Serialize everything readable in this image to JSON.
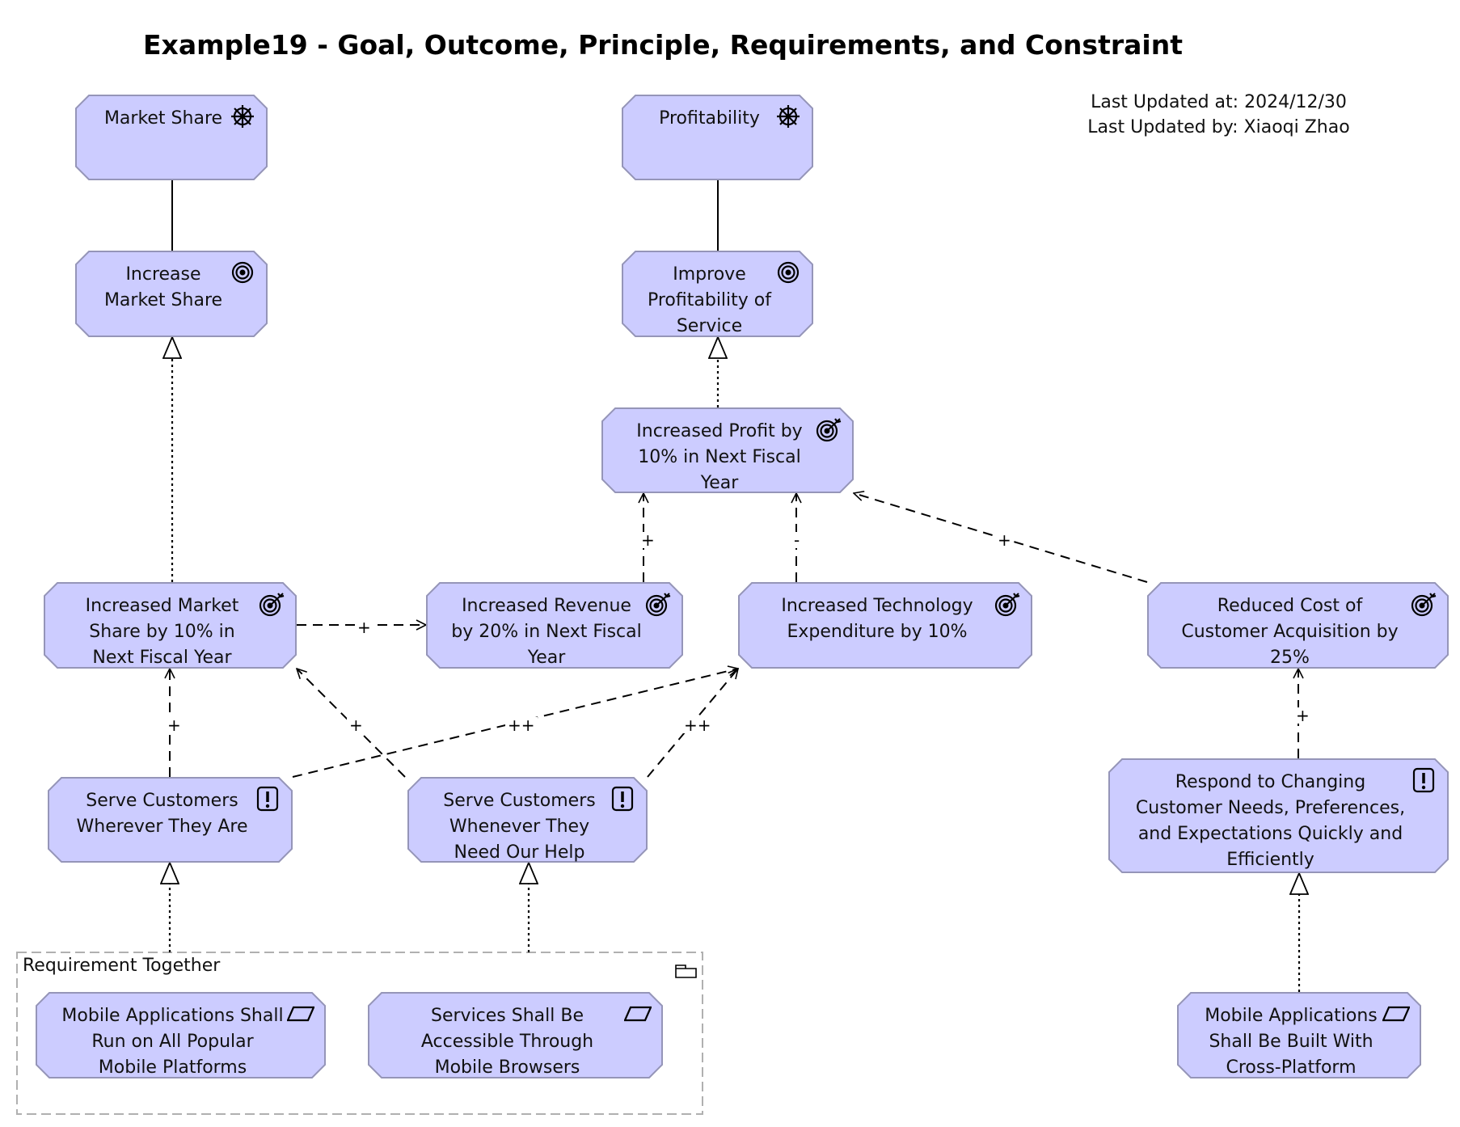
{
  "title": "Example19 - Goal, Outcome, Principle, Requirements, and Constraint",
  "meta": {
    "last_updated_at": "Last Updated at: 2024/12/30",
    "last_updated_by": "Last Updated by: Xiaoqi Zhao"
  },
  "colors": {
    "node_fill": "#ccccff",
    "node_border": "#9595b8",
    "line": "#000000",
    "group_border": "#b0b0b0"
  },
  "group": {
    "label": "Requirement Together",
    "icon": "folder-icon"
  },
  "nodes": {
    "market_share": {
      "label": "Market Share",
      "type": "driver",
      "icon": "driver-wheel-icon"
    },
    "profitability": {
      "label": "Profitability",
      "type": "driver",
      "icon": "driver-wheel-icon"
    },
    "increase_market_share": {
      "label": "Increase Market Share",
      "type": "goal",
      "icon": "goal-target-icon"
    },
    "improve_profitability": {
      "label": "Improve Profitability of Service",
      "type": "goal",
      "icon": "goal-target-icon"
    },
    "increased_profit": {
      "label": "Increased Profit by 10% in Next Fiscal Year",
      "type": "outcome",
      "icon": "outcome-arrow-target-icon"
    },
    "increased_market_share_10": {
      "label": "Increased Market Share by 10% in Next Fiscal Year",
      "type": "outcome",
      "icon": "outcome-arrow-target-icon"
    },
    "increased_revenue": {
      "label": "Increased Revenue by 20% in Next Fiscal Year",
      "type": "outcome",
      "icon": "outcome-arrow-target-icon"
    },
    "increased_tech": {
      "label": "Increased Technology Expenditure by 10%",
      "type": "outcome",
      "icon": "outcome-arrow-target-icon"
    },
    "reduced_cost": {
      "label": "Reduced Cost of Customer Acquisition by 25%",
      "type": "outcome",
      "icon": "outcome-arrow-target-icon"
    },
    "serve_wherever": {
      "label": "Serve Customers Wherever They Are",
      "type": "principle",
      "icon": "principle-exclamation-icon"
    },
    "serve_whenever": {
      "label": "Serve Customers Whenever They Need Our Help",
      "type": "principle",
      "icon": "principle-exclamation-icon"
    },
    "respond_changing": {
      "label": "Respond to Changing Customer Needs, Preferences, and Expectations Quickly and Efficiently",
      "type": "principle",
      "icon": "principle-exclamation-icon"
    },
    "mobile_run": {
      "label": "Mobile Applications Shall Run on All Popular Mobile Platforms",
      "type": "requirement",
      "icon": "requirement-parallelogram-icon"
    },
    "services_browsers": {
      "label": "Services Shall Be Accessible Through Mobile Browsers",
      "type": "requirement",
      "icon": "requirement-parallelogram-icon"
    },
    "mobile_built": {
      "label": "Mobile Applications Shall Be Built With Cross-Platform",
      "type": "requirement",
      "icon": "requirement-parallelogram-icon"
    }
  },
  "relations": [
    {
      "from": "market_share",
      "to": "increase_market_share",
      "type": "association",
      "label": ""
    },
    {
      "from": "profitability",
      "to": "improve_profitability",
      "type": "association",
      "label": ""
    },
    {
      "from": "increased_market_share_10",
      "to": "increase_market_share",
      "type": "realization",
      "label": ""
    },
    {
      "from": "increased_profit",
      "to": "improve_profitability",
      "type": "realization",
      "label": ""
    },
    {
      "from": "increased_revenue",
      "to": "increased_profit",
      "type": "influence",
      "label": "+"
    },
    {
      "from": "increased_tech",
      "to": "increased_profit",
      "type": "influence",
      "label": "-"
    },
    {
      "from": "reduced_cost",
      "to": "increased_profit",
      "type": "influence",
      "label": "+"
    },
    {
      "from": "increased_market_share_10",
      "to": "increased_revenue",
      "type": "influence",
      "label": "+"
    },
    {
      "from": "serve_wherever",
      "to": "increased_market_share_10",
      "type": "influence",
      "label": "+"
    },
    {
      "from": "serve_whenever",
      "to": "increased_market_share_10",
      "type": "influence",
      "label": "+"
    },
    {
      "from": "serve_wherever",
      "to": "increased_tech",
      "type": "influence",
      "label": "++"
    },
    {
      "from": "serve_whenever",
      "to": "increased_tech",
      "type": "influence",
      "label": "++"
    },
    {
      "from": "respond_changing",
      "to": "reduced_cost",
      "type": "influence",
      "label": "+"
    },
    {
      "from": "group",
      "to": "serve_wherever",
      "type": "realization",
      "label": ""
    },
    {
      "from": "group",
      "to": "serve_whenever",
      "type": "realization",
      "label": ""
    },
    {
      "from": "mobile_built",
      "to": "respond_changing",
      "type": "realization",
      "label": ""
    }
  ]
}
